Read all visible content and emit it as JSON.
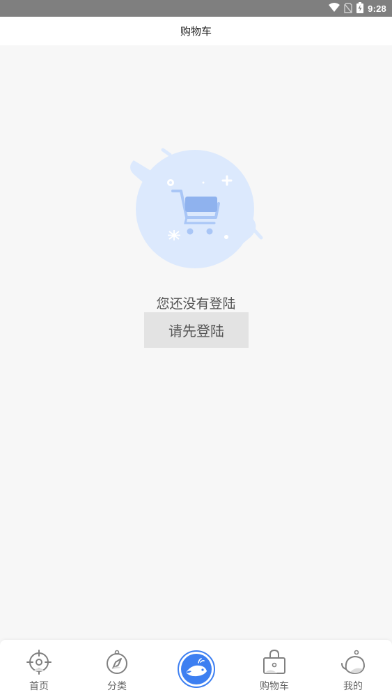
{
  "status_bar": {
    "time": "9:28",
    "icons": [
      "wifi-icon",
      "no-sim-icon",
      "battery-charging-icon"
    ]
  },
  "header": {
    "title": "购物车"
  },
  "empty_state": {
    "illustration": "empty-cart-illustration",
    "message": "您还没有登陆",
    "login_button_label": "请先登陆"
  },
  "tab_bar": {
    "items": [
      {
        "label": "首页",
        "icon": "home-target-icon"
      },
      {
        "label": "分类",
        "icon": "compass-icon"
      },
      {
        "label": "",
        "icon": "whale-center-icon"
      },
      {
        "label": "购物车",
        "icon": "shopping-bag-icon"
      },
      {
        "label": "我的",
        "icon": "profile-whale-icon"
      }
    ]
  },
  "colors": {
    "status_bar_bg": "#7f7f7f",
    "page_bg": "#f7f7f7",
    "illustration_circle": "#dce9fd",
    "illustration_cart": "#a9c6f6",
    "center_tab_blue": "#3d7ff1",
    "button_bg": "#e3e3e3"
  }
}
